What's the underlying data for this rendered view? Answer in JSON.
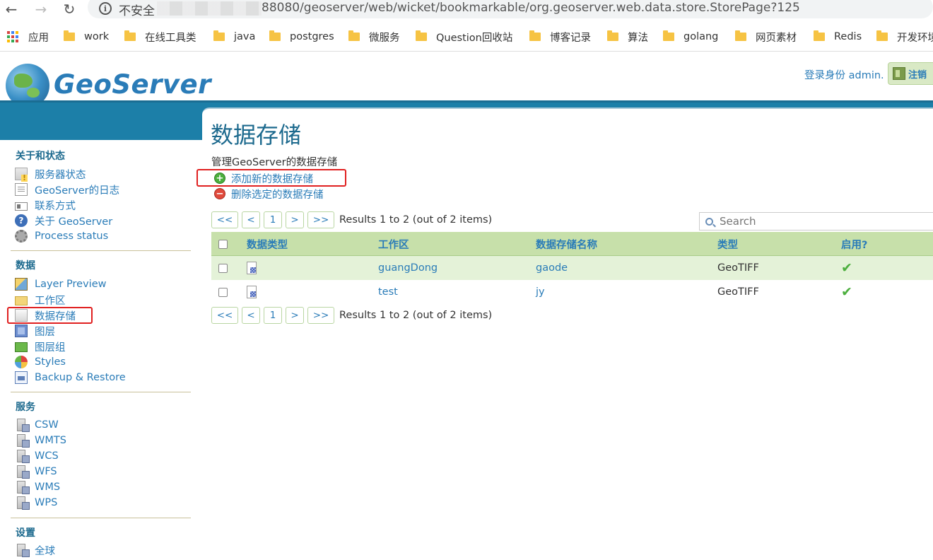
{
  "browser": {
    "insecure_label": "不安全",
    "url": "88080/geoserver/web/wicket/bookmarkable/org.geoserver.web.data.store.StorePage?125",
    "bookmarks": [
      {
        "label": "应用",
        "kind": "apps"
      },
      {
        "label": "work",
        "kind": "folder"
      },
      {
        "label": "在线工具类",
        "kind": "folder"
      },
      {
        "label": "java",
        "kind": "folder"
      },
      {
        "label": "postgres",
        "kind": "folder"
      },
      {
        "label": "微服务",
        "kind": "folder"
      },
      {
        "label": "Question回收站",
        "kind": "folder"
      },
      {
        "label": "博客记录",
        "kind": "folder"
      },
      {
        "label": "算法",
        "kind": "folder"
      },
      {
        "label": "golang",
        "kind": "folder"
      },
      {
        "label": "网页素材",
        "kind": "folder"
      },
      {
        "label": "Redis",
        "kind": "folder"
      },
      {
        "label": "开发环境",
        "kind": "folder"
      }
    ]
  },
  "header": {
    "logo_text": "GeoServer",
    "login_info": "登录身份 admin.",
    "logout_label": "注销"
  },
  "sidebar": {
    "sections": [
      {
        "title": "关于和状态",
        "items": [
          {
            "label": "服务器状态",
            "icon": "server-status-icon"
          },
          {
            "label": "GeoServer的日志",
            "icon": "log-icon"
          },
          {
            "label": "联系方式",
            "icon": "contact-icon"
          },
          {
            "label": "关于 GeoServer",
            "icon": "help-icon"
          },
          {
            "label": "Process status",
            "icon": "gear-icon"
          }
        ]
      },
      {
        "title": "数据",
        "items": [
          {
            "label": "Layer Preview",
            "icon": "map-icon"
          },
          {
            "label": "工作区",
            "icon": "folder-icon"
          },
          {
            "label": "数据存储",
            "icon": "datastore-icon"
          },
          {
            "label": "图层",
            "icon": "layer-icon"
          },
          {
            "label": "图层组",
            "icon": "layer-group-icon"
          },
          {
            "label": "Styles",
            "icon": "styles-icon"
          },
          {
            "label": "Backup & Restore",
            "icon": "backup-icon"
          }
        ]
      },
      {
        "title": "服务",
        "items": [
          {
            "label": "CSW",
            "icon": "service-icon"
          },
          {
            "label": "WMTS",
            "icon": "service-icon"
          },
          {
            "label": "WCS",
            "icon": "service-icon"
          },
          {
            "label": "WFS",
            "icon": "service-icon"
          },
          {
            "label": "WMS",
            "icon": "service-icon"
          },
          {
            "label": "WPS",
            "icon": "service-icon"
          }
        ]
      },
      {
        "title": "设置",
        "items": [
          {
            "label": "全球",
            "icon": "service-icon"
          }
        ]
      }
    ]
  },
  "main": {
    "title": "数据存储",
    "description": "管理GeoServer的数据存储",
    "add_label": "添加新的数据存储",
    "remove_label": "删除选定的数据存储",
    "pager": {
      "first": "<<",
      "prev": "<",
      "page": "1",
      "next": ">",
      "last": ">>",
      "results_text": "Results 1 to 2 (out of 2 items)"
    },
    "search_placeholder": "Search",
    "table": {
      "columns": [
        "数据类型",
        "工作区",
        "数据存储名称",
        "类型",
        "启用?"
      ],
      "rows": [
        {
          "workspace": "guangDong",
          "name": "gaode",
          "type": "GeoTIFF",
          "enabled": "✔"
        },
        {
          "workspace": "test",
          "name": "jy",
          "type": "GeoTIFF",
          "enabled": "✔"
        }
      ]
    }
  }
}
